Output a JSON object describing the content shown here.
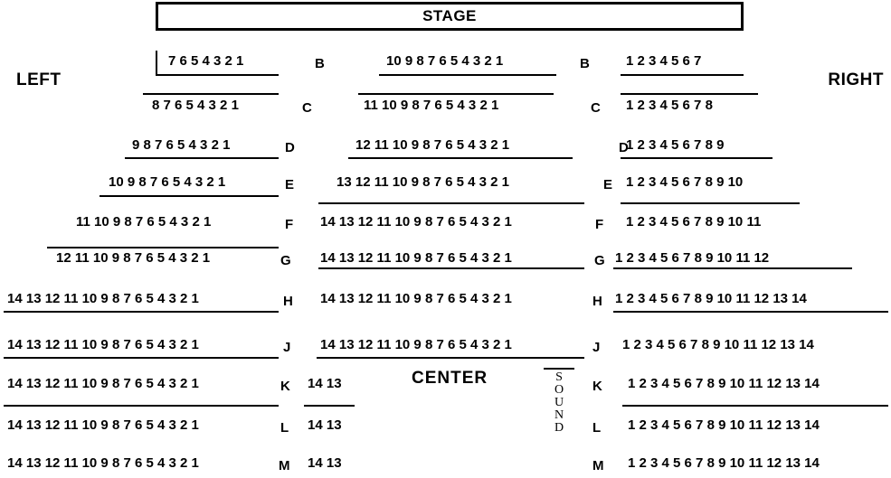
{
  "stage": {
    "label": "STAGE"
  },
  "orientation": {
    "left": "LEFT",
    "right": "RIGHT",
    "center": "CENTER"
  },
  "sound_booth": {
    "letters": [
      "S",
      "O",
      "U",
      "N",
      "D"
    ],
    "label": "SOUND"
  },
  "rows": [
    {
      "letter": "B",
      "left": "7 6 5 4 3 2 1",
      "center": "10 9 8 7 6 5 4 3 2 1",
      "right": "1 2 3 4 5 6 7"
    },
    {
      "letter": "C",
      "left": "8 7 6 5 4 3 2 1",
      "center": "11 10 9 8 7 6 5 4 3 2 1",
      "right": "1 2 3 4 5 6 7 8"
    },
    {
      "letter": "D",
      "left": "9 8 7 6 5 4 3 2 1",
      "center": "12 11 10 9 8 7 6 5 4 3 2 1",
      "right": "1 2 3 4 5 6 7 8 9"
    },
    {
      "letter": "E",
      "left": "10 9 8 7 6 5 4 3 2 1",
      "center": "13 12 11 10 9 8 7 6 5 4 3 2 1",
      "right": "1 2 3 4 5 6 7 8 9 10"
    },
    {
      "letter": "F",
      "left": "11 10 9 8 7 6 5 4 3 2 1",
      "center": "14 13 12 11 10 9 8 7 6 5 4 3 2 1",
      "right": "1 2 3 4 5 6 7 8 9 10 11"
    },
    {
      "letter": "G",
      "left": "12 11 10 9 8 7 6 5 4 3 2 1",
      "center": "14 13 12 11 10 9 8 7 6 5 4 3 2 1",
      "right": "1 2 3 4 5 6 7 8 9 10 11 12"
    },
    {
      "letter": "H",
      "left": "14 13 12 11 10 9 8 7 6 5 4 3 2 1",
      "center": "14 13 12 11 10 9 8 7 6 5 4 3 2 1",
      "right": "1 2 3 4 5 6 7 8 9 10 11 12 13 14"
    },
    {
      "letter": "J",
      "left": "14 13 12 11 10 9 8 7 6 5 4 3 2 1",
      "center": "14 13 12 11 10 9 8 7 6 5 4 3 2 1",
      "right": "1 2 3 4 5 6 7 8 9 10 11 12 13 14"
    },
    {
      "letter": "K",
      "left": "14 13 12 11 10 9 8 7 6 5 4 3 2 1",
      "center": "14 13",
      "right": "1 2 3 4 5 6 7 8 9 10 11 12 13 14"
    },
    {
      "letter": "L",
      "left": "14 13 12 11 10 9 8 7 6 5 4 3 2 1",
      "center": "14 13",
      "right": "1 2 3 4 5 6 7 8 9 10 11 12 13 14"
    },
    {
      "letter": "M",
      "left": "14 13 12 11 10 9 8 7 6 5 4 3 2 1",
      "center": "14 13",
      "right": "1 2 3 4 5 6 7 8 9 10 11 12 13 14"
    }
  ]
}
